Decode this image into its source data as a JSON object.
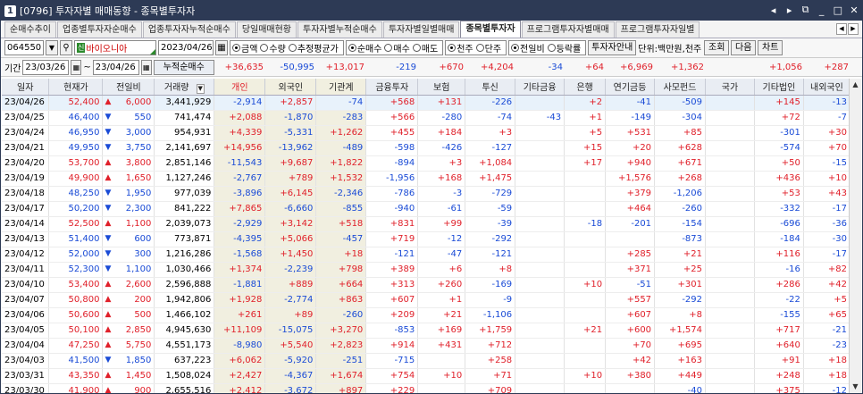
{
  "window": {
    "code": "1",
    "title": "[0796] 투자자별 매매동향 - 종목별투자자",
    "controls": [
      "◂",
      "▸",
      "⧉",
      "_",
      "□",
      "✕"
    ]
  },
  "tabs": [
    "순매수추이",
    "업종별투자자순매수",
    "업종투자자누적순매수",
    "당일매매현황",
    "투자자별누적순매수",
    "투자자별일별매매",
    "종목별투자자",
    "프로그램투자자별매매",
    "프로그램투자자일별"
  ],
  "active_tab": 6,
  "toolbar": {
    "code": "064550",
    "stock_badge": "신",
    "stock_name": "바이오니아",
    "date": "2023/04/26",
    "amount_opts": [
      "금액",
      "수량",
      "추정평균가"
    ],
    "amount_sel": 0,
    "trade_opts": [
      "순매수",
      "매수",
      "매도"
    ],
    "trade_sel": 0,
    "unit_opts": [
      "천주",
      "단주"
    ],
    "unit_sel": 0,
    "change_opts": [
      "전일비",
      "등락률"
    ],
    "change_sel": 0,
    "guide_btn": "투자자안내",
    "unit_label": "단위:백만원,천주",
    "query_btn": "조회",
    "next_btn": "다음",
    "chart_btn": "차트"
  },
  "period": {
    "label": "기간",
    "from": "23/03/26",
    "to": "23/04/26",
    "accum_label": "누적순매수",
    "sums": [
      "+36,635",
      "-50,995",
      "+13,017",
      "-219",
      "+670",
      "+4,204",
      "-34",
      "+64",
      "+6,969",
      "+1,362",
      "",
      "+1,056",
      "+287"
    ]
  },
  "columns": [
    "일자",
    "현재가",
    "전일비",
    "거래량",
    "개인",
    "외국인",
    "기관계",
    "금융투자",
    "보험",
    "투신",
    "기타금융",
    "은행",
    "연기금등",
    "사모펀드",
    "국가",
    "기타법인",
    "내외국인"
  ],
  "rows": [
    [
      "23/04/26",
      "52,400",
      "▲",
      "6,000",
      "3,441,929",
      "-2,914",
      "+2,857",
      "-74",
      "+568",
      "+131",
      "-226",
      "",
      "+2",
      "-41",
      "-509",
      "",
      "+145",
      "-13"
    ],
    [
      "23/04/25",
      "46,400",
      "▼",
      "550",
      "741,474",
      "+2,088",
      "-1,870",
      "-283",
      "+566",
      "-280",
      "-74",
      "-43",
      "+1",
      "-149",
      "-304",
      "",
      "+72",
      "-7"
    ],
    [
      "23/04/24",
      "46,950",
      "▼",
      "3,000",
      "954,931",
      "+4,339",
      "-5,331",
      "+1,262",
      "+455",
      "+184",
      "+3",
      "",
      "+5",
      "+531",
      "+85",
      "",
      "-301",
      "+30"
    ],
    [
      "23/04/21",
      "49,950",
      "▼",
      "3,750",
      "2,141,697",
      "+14,956",
      "-13,962",
      "-489",
      "-598",
      "-426",
      "-127",
      "",
      "+15",
      "+20",
      "+628",
      "",
      "-574",
      "+70"
    ],
    [
      "23/04/20",
      "53,700",
      "▲",
      "3,800",
      "2,851,146",
      "-11,543",
      "+9,687",
      "+1,822",
      "-894",
      "+3",
      "+1,084",
      "",
      "+17",
      "+940",
      "+671",
      "",
      "+50",
      "-15"
    ],
    [
      "23/04/19",
      "49,900",
      "▲",
      "1,650",
      "1,127,246",
      "-2,767",
      "+789",
      "+1,532",
      "-1,956",
      "+168",
      "+1,475",
      "",
      "",
      "+1,576",
      "+268",
      "",
      "+436",
      "+10"
    ],
    [
      "23/04/18",
      "48,250",
      "▼",
      "1,950",
      "977,039",
      "-3,896",
      "+6,145",
      "-2,346",
      "-786",
      "-3",
      "-729",
      "",
      "",
      "+379",
      "-1,206",
      "",
      "+53",
      "+43"
    ],
    [
      "23/04/17",
      "50,200",
      "▼",
      "2,300",
      "841,222",
      "+7,865",
      "-6,660",
      "-855",
      "-940",
      "-61",
      "-59",
      "",
      "",
      "+464",
      "-260",
      "",
      "-332",
      "-17"
    ],
    [
      "23/04/14",
      "52,500",
      "▲",
      "1,100",
      "2,039,073",
      "-2,929",
      "+3,142",
      "+518",
      "+831",
      "+99",
      "-39",
      "",
      "-18",
      "-201",
      "-154",
      "",
      "-696",
      "-36"
    ],
    [
      "23/04/13",
      "51,400",
      "▼",
      "600",
      "773,871",
      "-4,395",
      "+5,066",
      "-457",
      "+719",
      "-12",
      "-292",
      "",
      "",
      "",
      "-873",
      "",
      "-184",
      "-30"
    ],
    [
      "23/04/12",
      "52,000",
      "▼",
      "300",
      "1,216,286",
      "-1,568",
      "+1,450",
      "+18",
      "-121",
      "-47",
      "-121",
      "",
      "",
      "+285",
      "+21",
      "",
      "+116",
      "-17"
    ],
    [
      "23/04/11",
      "52,300",
      "▼",
      "1,100",
      "1,030,466",
      "+1,374",
      "-2,239",
      "+798",
      "+389",
      "+6",
      "+8",
      "",
      "",
      "+371",
      "+25",
      "",
      "-16",
      "+82"
    ],
    [
      "23/04/10",
      "53,400",
      "▲",
      "2,600",
      "2,596,888",
      "-1,881",
      "+889",
      "+664",
      "+313",
      "+260",
      "-169",
      "",
      "+10",
      "-51",
      "+301",
      "",
      "+286",
      "+42"
    ],
    [
      "23/04/07",
      "50,800",
      "▲",
      "200",
      "1,942,806",
      "+1,928",
      "-2,774",
      "+863",
      "+607",
      "+1",
      "-9",
      "",
      "",
      "+557",
      "-292",
      "",
      "-22",
      "+5"
    ],
    [
      "23/04/06",
      "50,600",
      "▲",
      "500",
      "1,466,102",
      "+261",
      "+89",
      "-260",
      "+209",
      "+21",
      "-1,106",
      "",
      "",
      "+607",
      "+8",
      "",
      "-155",
      "+65"
    ],
    [
      "23/04/05",
      "50,100",
      "▲",
      "2,850",
      "4,945,630",
      "+11,109",
      "-15,075",
      "+3,270",
      "-853",
      "+169",
      "+1,759",
      "",
      "+21",
      "+600",
      "+1,574",
      "",
      "+717",
      "-21"
    ],
    [
      "23/04/04",
      "47,250",
      "▲",
      "5,750",
      "4,551,173",
      "-8,980",
      "+5,540",
      "+2,823",
      "+914",
      "+431",
      "+712",
      "",
      "",
      "+70",
      "+695",
      "",
      "+640",
      "-23"
    ],
    [
      "23/04/03",
      "41,500",
      "▼",
      "1,850",
      "637,223",
      "+6,062",
      "-5,920",
      "-251",
      "-715",
      "",
      "+258",
      "",
      "",
      "+42",
      "+163",
      "",
      "+91",
      "+18"
    ],
    [
      "23/03/31",
      "43,350",
      "▲",
      "1,450",
      "1,508,024",
      "+2,427",
      "-4,367",
      "+1,674",
      "+754",
      "+10",
      "+71",
      "",
      "+10",
      "+380",
      "+449",
      "",
      "+248",
      "+18"
    ],
    [
      "23/03/30",
      "41,900",
      "▲",
      "900",
      "2,655,516",
      "+2,412",
      "-3,672",
      "+897",
      "+229",
      "",
      "+709",
      "",
      "",
      "",
      "-40",
      "",
      "+375",
      "-12"
    ]
  ],
  "colors": {
    "titlebar": "#2d3a55",
    "up": "#e0202a",
    "down": "#1a4bd6",
    "selected_row": "#e8f2fb",
    "highlight_col": "#f1efe0"
  }
}
